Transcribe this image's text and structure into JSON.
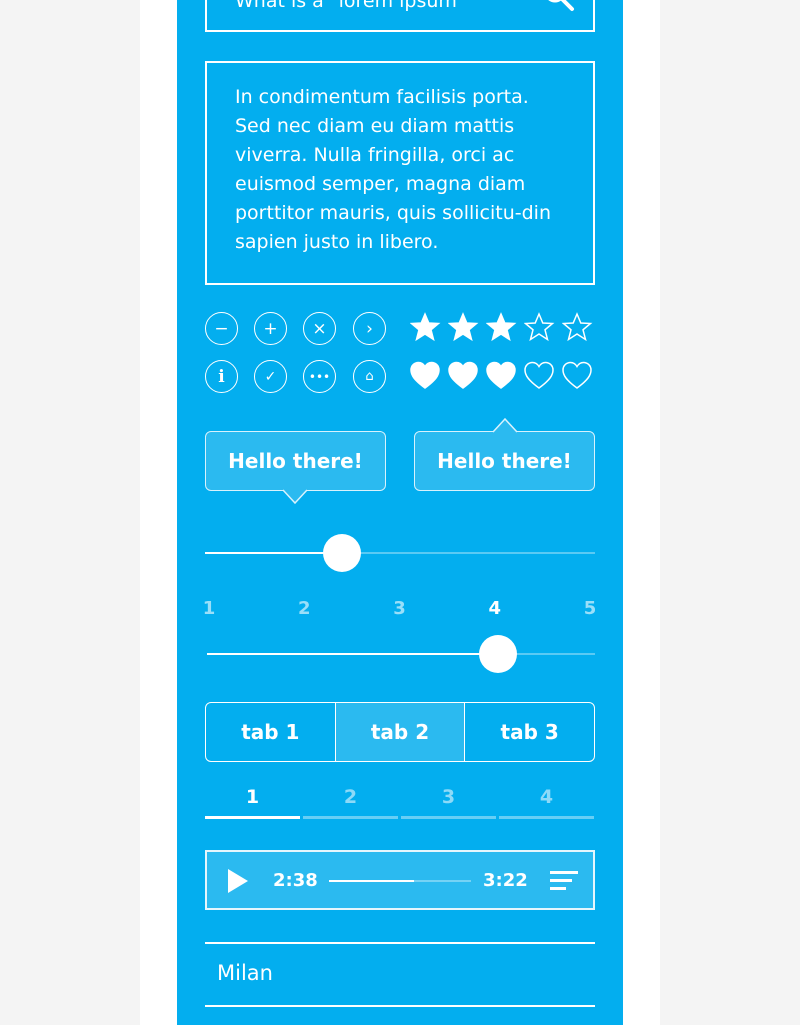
{
  "search": {
    "value": "What is a \"lorem ipsum\"",
    "icon": "search-icon"
  },
  "paragraph": "In condimentum facilisis porta. Sed nec diam eu diam mattis viverra. Nulla fringilla, orci ac euismod semper, magna diam porttitor mauris, quis sollicitu-din sapien justo in libero.",
  "icons": [
    "minus-icon",
    "plus-icon",
    "close-icon",
    "chevron-right-icon",
    "info-icon",
    "check-icon",
    "more-icon",
    "home-icon"
  ],
  "rating": {
    "stars": 3,
    "max": 5,
    "hearts": 3
  },
  "tooltips": [
    "Hello there!",
    "Hello there!"
  ],
  "slider1": {
    "value": 0.35
  },
  "slider2": {
    "labels": [
      "1",
      "2",
      "3",
      "4",
      "5"
    ],
    "value": 4
  },
  "tabs": {
    "items": [
      "tab 1",
      "tab 2",
      "tab 3"
    ],
    "active": 1
  },
  "steps": {
    "items": [
      "1",
      "2",
      "3",
      "4"
    ],
    "active": 0
  },
  "player": {
    "current": "2:38",
    "total": "3:22",
    "progress": 0.6
  },
  "list": {
    "items": [
      "Milan"
    ]
  },
  "colors": {
    "accent": "#03aeef",
    "light": "#2bbaf0"
  }
}
